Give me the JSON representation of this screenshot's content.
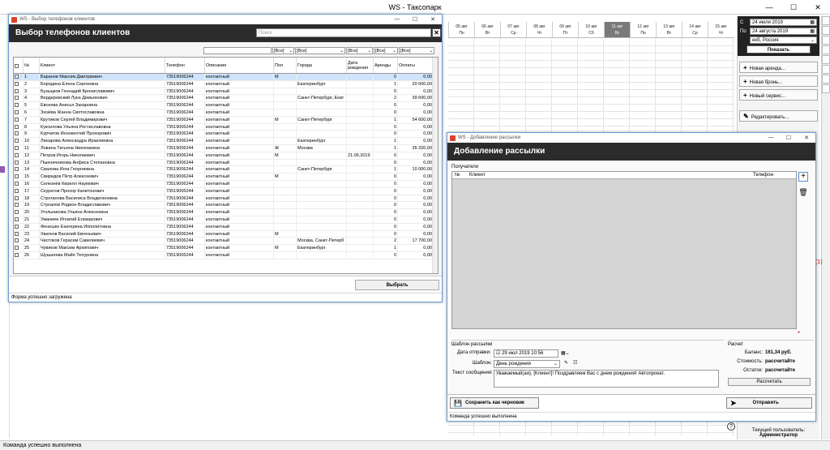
{
  "app": {
    "title": "WS - Таксопарк",
    "status": "Команда успешно выполнена"
  },
  "schedule": {
    "days": [
      {
        "d": "05 авг",
        "w": "Пн",
        "hl": false
      },
      {
        "d": "06 авг",
        "w": "Вт",
        "hl": false
      },
      {
        "d": "07 авг",
        "w": "Ср",
        "hl": false
      },
      {
        "d": "08 авг",
        "w": "Чт",
        "hl": false
      },
      {
        "d": "09 авг",
        "w": "Пт",
        "hl": false
      },
      {
        "d": "10 авг",
        "w": "Сб",
        "hl": false
      },
      {
        "d": "11 авг",
        "w": "Вс",
        "hl": true
      },
      {
        "d": "12 авг",
        "w": "Пн",
        "hl": false
      },
      {
        "d": "13 авг",
        "w": "Вт",
        "hl": false
      },
      {
        "d": "14 авг",
        "w": "Ср",
        "hl": false
      },
      {
        "d": "15 авг",
        "w": "Чт",
        "hl": false
      }
    ]
  },
  "right_panel": {
    "from_label": "С",
    "to_label": "По",
    "from_day": "24",
    "from_month": "июля",
    "from_year": "2019",
    "to_day": "24",
    "to_month": "августа",
    "to_year": "2019",
    "city": "екб, Россия",
    "show": "Показать",
    "new_rent": "Новая аренда...",
    "new_booking": "Новая бронь...",
    "new_service": "Новый сервис...",
    "edit": "Редактировать...",
    "user_label": "Текущий пользователь:",
    "user_name": "Администратор",
    "red_note": "(1)"
  },
  "win1": {
    "title": "WS - Выбор телефонов клиентов",
    "header": "Выбор телефонов клиентов",
    "search_placeholder": "Поиск",
    "filter_all": "[Все]",
    "columns": [
      "№",
      "Клиент",
      "Телефон",
      "Описание",
      "Пол",
      "Города",
      "Дата рождения",
      "Аренды",
      "Оплаты"
    ],
    "rows": [
      [
        "1",
        "Баранов Максим Дмитриевич",
        "73519006244",
        "контактный",
        "М",
        "",
        "",
        "0",
        "0,00"
      ],
      [
        "2",
        "Бородина Елена Сергеевна",
        "73519006244",
        "контактный",
        "",
        "Екатеринбург",
        "",
        "1",
        "20 000,00"
      ],
      [
        "3",
        "Бузыцков Геннадий Брониславович",
        "73519006244",
        "контактный",
        "",
        "",
        "",
        "0",
        "0,00"
      ],
      [
        "4",
        "Вердеревский Лука Демьянович",
        "73519006244",
        "контактный",
        "",
        "Санкт-Петербург, Екат",
        "",
        "2",
        "39 600,00"
      ],
      [
        "5",
        "Евсеева Анисья Захаровна",
        "73519006244",
        "контактный",
        "",
        "",
        "",
        "0",
        "0,00"
      ],
      [
        "6",
        "Зюзёва Жанна Святославовна",
        "73519006244",
        "контактный",
        "",
        "",
        "",
        "0",
        "0,00"
      ],
      [
        "7",
        "Крутиков Сергей Владимирович",
        "73519006244",
        "контактный",
        "М",
        "Санкт-Петербург",
        "",
        "1",
        "54 600,00"
      ],
      [
        "8",
        "Куксилова Ульяна Ростиславовна",
        "73519006244",
        "контактный",
        "",
        "",
        "",
        "0",
        "0,00"
      ],
      [
        "9",
        "Курчатов Иннокентий Прохорович",
        "73519006244",
        "контактный",
        "",
        "",
        "",
        "0",
        "0,00"
      ],
      [
        "10",
        "Линарова Александра Ираклиевна",
        "73519006244",
        "контактный",
        "",
        "Екатеринбург",
        "",
        "1",
        "0,00"
      ],
      [
        "11",
        "Ловина Татьяна Николаевна",
        "73519006244",
        "контактный",
        "Ж",
        "Москва",
        "",
        "1",
        "35 320,00"
      ],
      [
        "12",
        "Петров Игорь Николаевич",
        "73519006244",
        "контактный",
        "М",
        "",
        "21.06.2019",
        "0",
        "0,00"
      ],
      [
        "13",
        "Пшеничникова Анфиса Степановна",
        "73519006244",
        "контактный",
        "",
        "",
        "",
        "0",
        "0,00"
      ],
      [
        "14",
        "Свалова Инга Георгиевна",
        "73519006244",
        "контактный",
        "",
        "Санкт-Петербург",
        "",
        "1",
        "10 000,00"
      ],
      [
        "15",
        "Свиридов Пётр Алексеевич",
        "73519006244",
        "контактный",
        "М",
        "",
        "",
        "0",
        "0,00"
      ],
      [
        "16",
        "Селезнёв Кирилл Наумович",
        "73519006244",
        "контактный",
        "",
        "",
        "",
        "0",
        "0,00"
      ],
      [
        "17",
        "Скуратов Прохор Капитонович",
        "73519006244",
        "контактный",
        "",
        "",
        "",
        "0",
        "0,00"
      ],
      [
        "18",
        "Строганова Василиса Владиленовна",
        "73519006244",
        "контактный",
        "",
        "",
        "",
        "0",
        "0,00"
      ],
      [
        "19",
        "Стукалов Родион Владиславович",
        "73519006244",
        "контактный",
        "",
        "",
        "",
        "0",
        "0,00"
      ],
      [
        "20",
        "Угольникова Ульяна Алексеевна",
        "73519006244",
        "контактный",
        "",
        "",
        "",
        "0",
        "0,00"
      ],
      [
        "21",
        "Уманиев Игнатий Елизарович",
        "73519006244",
        "контактный",
        "",
        "",
        "",
        "0",
        "0,00"
      ],
      [
        "22",
        "Фенешко Екатерина Ипполитовна",
        "73519006244",
        "контактный",
        "",
        "",
        "",
        "0",
        "0,00"
      ],
      [
        "23",
        "Хватков Василий Евгеньевич",
        "73519006244",
        "контактный",
        "М",
        "",
        "",
        "0",
        "0,00"
      ],
      [
        "24",
        "Чистяков Герасим Савелиевич",
        "73519006244",
        "контактный",
        "",
        "Москва, Санкт-Петерб",
        "",
        "2",
        "17 700,00"
      ],
      [
        "25",
        "Чувиков Максим Архипович",
        "73519006244",
        "контактный",
        "М",
        "Екатеринбург",
        "",
        "1",
        "0,00"
      ],
      [
        "26",
        "Шушалева Майя Тепуровна",
        "73519006244",
        "контактный",
        "",
        "",
        "",
        "0",
        "0,00"
      ]
    ],
    "select_btn": "Выбрать",
    "status": "Форма успешно загружена"
  },
  "win2": {
    "title": "WS - Добавление рассылки",
    "header": "Добавление рассылки",
    "recipients_label": "Получатели",
    "col_n": "№",
    "col_client": "Клиент",
    "col_phone": "Телефон",
    "tpl_label": "Шаблон рассылки",
    "send_date_label": "Дата отправки:",
    "send_date": "29 июл 2019 10:56",
    "template_label": "Шаблон:",
    "template_value": "День рождения",
    "msg_label": "Текст сообщения:",
    "msg_text": "Уважаемый(ая), [Клиент]! Поздравляем Вас с днем рождения! Автопрокат.",
    "calc_label": "Расчет",
    "balance_label": "Баланс:",
    "balance_value": "161,34 руб.",
    "cost_label": "Стоимость:",
    "cost_value": "рассчитайте",
    "rest_label": "Остаток:",
    "rest_value": "рассчитайте",
    "calc_btn": "Рассчитать",
    "save_btn": "Сохранить как черновик",
    "send_btn": "Отправить",
    "status": "Команда успешно выполнена"
  }
}
